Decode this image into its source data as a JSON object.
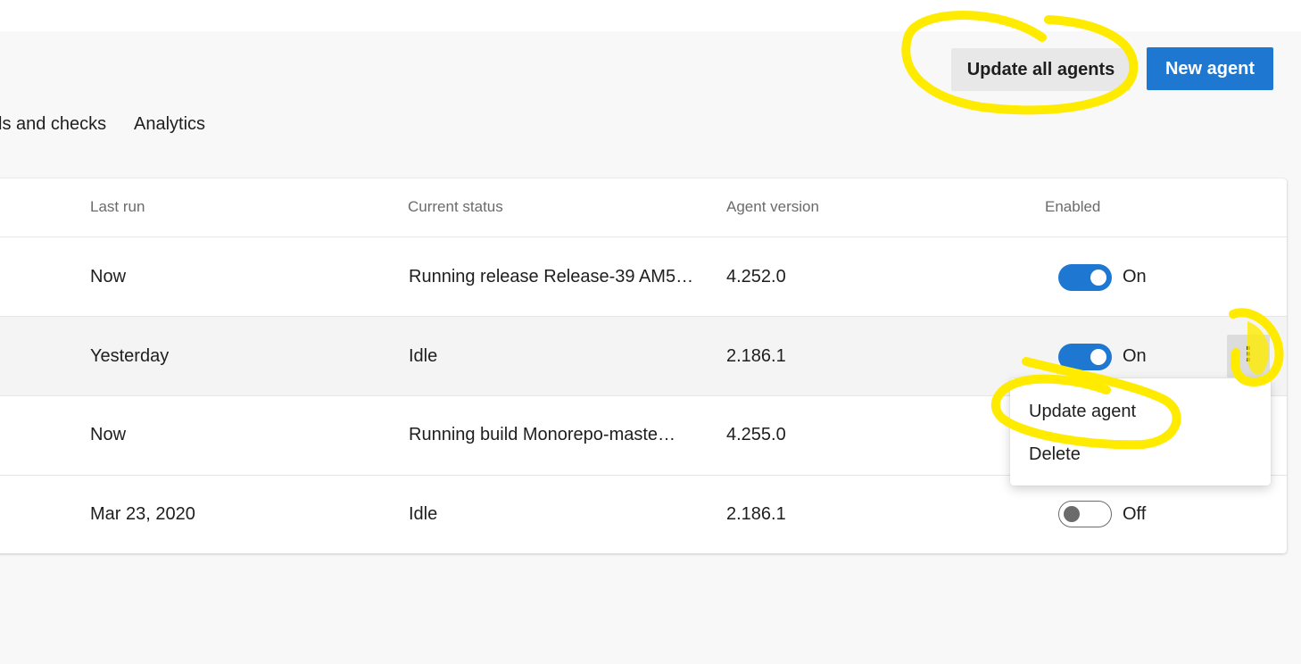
{
  "header": {
    "update_all_label": "Update all agents",
    "new_agent_label": "New agent"
  },
  "tabs": [
    {
      "label": "ls and checks"
    },
    {
      "label": "Analytics"
    }
  ],
  "table": {
    "columns": [
      "Last run",
      "Current status",
      "Agent version",
      "Enabled"
    ],
    "rows": [
      {
        "last_run": "Now",
        "status": "Running release Release-39 AM5…",
        "version": "4.252.0",
        "enabled": true,
        "enabled_label": "On"
      },
      {
        "last_run": "Yesterday",
        "status": "Idle",
        "version": "2.186.1",
        "enabled": true,
        "enabled_label": "On"
      },
      {
        "last_run": "Now",
        "status": "Running build Monorepo-maste…",
        "version": "4.255.0",
        "enabled": true,
        "enabled_label": ""
      },
      {
        "last_run": "Mar 23, 2020",
        "status": "Idle",
        "version": "2.186.1",
        "enabled": false,
        "enabled_label": "Off"
      }
    ]
  },
  "context_menu": {
    "items": [
      "Update agent",
      "Delete"
    ]
  },
  "more_button": {
    "glyph": "⋮"
  },
  "colors": {
    "accent": "#1e78d2",
    "annotation": "#ffeb00"
  }
}
